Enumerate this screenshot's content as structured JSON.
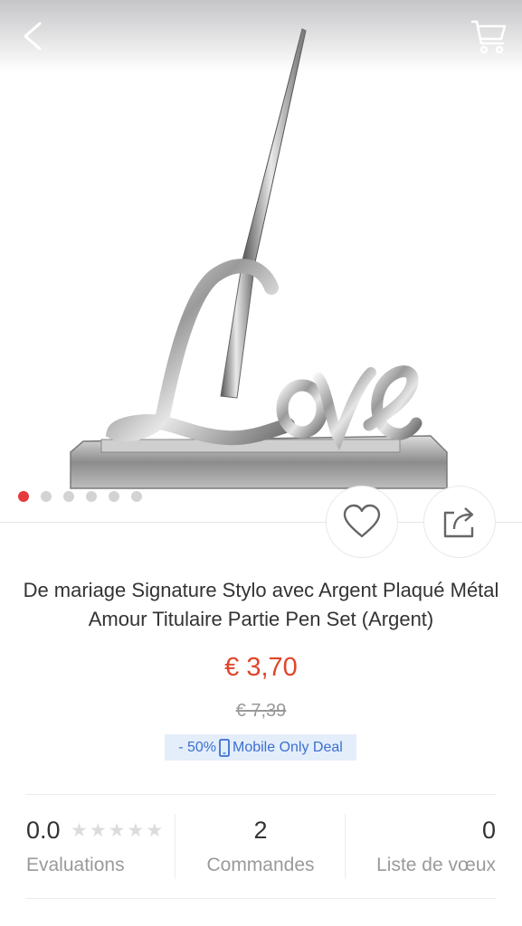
{
  "header": {
    "back_icon": "chevron-left-icon",
    "cart_icon": "shopping-cart-icon"
  },
  "gallery": {
    "dot_count": 6,
    "active_index": 0,
    "image_word": "Love"
  },
  "actions": {
    "wishlist_icon": "heart-icon",
    "share_icon": "share-icon"
  },
  "product": {
    "title": "De mariage Signature Stylo avec Argent Plaqué Métal Amour Titulaire Partie Pen Set (Argent)",
    "price": "€ 3,70",
    "old_price": "€ 7,39",
    "discount": "- 50%",
    "deal_label": "Mobile Only Deal"
  },
  "stats": {
    "rating_value": "0.0",
    "rating_stars": 0,
    "rating_label": "Evaluations",
    "orders_value": "2",
    "orders_label": "Commandes",
    "wishlist_value": "0",
    "wishlist_label": "Liste de vœux"
  },
  "colors": {
    "price": "#e0452a",
    "active_dot": "#e53a3a",
    "deal_bg": "#e4eefb",
    "deal_text": "#3b6fd0"
  }
}
